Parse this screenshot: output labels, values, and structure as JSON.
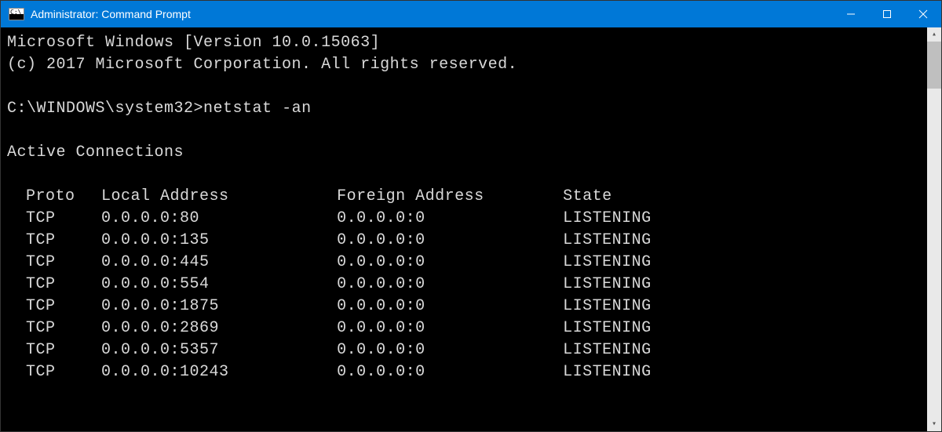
{
  "window": {
    "title": "Administrator: Command Prompt"
  },
  "terminal": {
    "line1": "Microsoft Windows [Version 10.0.15063]",
    "line2": "(c) 2017 Microsoft Corporation. All rights reserved.",
    "prompt": "C:\\WINDOWS\\system32>",
    "command": "netstat -an",
    "section_header": "Active Connections",
    "columns": {
      "proto": "Proto",
      "local": "Local Address",
      "foreign": "Foreign Address",
      "state": "State"
    },
    "rows": [
      {
        "proto": "TCP",
        "local": "0.0.0.0:80",
        "foreign": "0.0.0.0:0",
        "state": "LISTENING"
      },
      {
        "proto": "TCP",
        "local": "0.0.0.0:135",
        "foreign": "0.0.0.0:0",
        "state": "LISTENING"
      },
      {
        "proto": "TCP",
        "local": "0.0.0.0:445",
        "foreign": "0.0.0.0:0",
        "state": "LISTENING"
      },
      {
        "proto": "TCP",
        "local": "0.0.0.0:554",
        "foreign": "0.0.0.0:0",
        "state": "LISTENING"
      },
      {
        "proto": "TCP",
        "local": "0.0.0.0:1875",
        "foreign": "0.0.0.0:0",
        "state": "LISTENING"
      },
      {
        "proto": "TCP",
        "local": "0.0.0.0:2869",
        "foreign": "0.0.0.0:0",
        "state": "LISTENING"
      },
      {
        "proto": "TCP",
        "local": "0.0.0.0:5357",
        "foreign": "0.0.0.0:0",
        "state": "LISTENING"
      },
      {
        "proto": "TCP",
        "local": "0.0.0.0:10243",
        "foreign": "0.0.0.0:0",
        "state": "LISTENING"
      }
    ]
  }
}
